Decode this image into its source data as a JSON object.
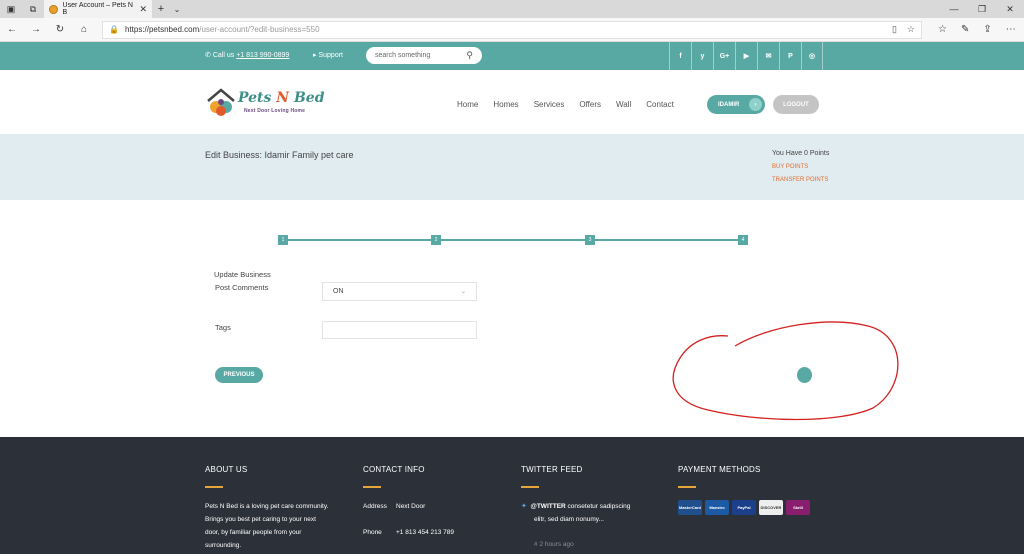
{
  "browser": {
    "tab_title": "User Account – Pets N B",
    "url_host": "https://petsnbed.com",
    "url_path": "/user-account/?edit-business=550"
  },
  "topbar": {
    "call_prefix": "Call us",
    "phone": "+1 813 990-0899",
    "support": "Support",
    "search_placeholder": "search something",
    "social": [
      "f",
      "y",
      "G+",
      "▶",
      "✉",
      "P",
      "◎"
    ]
  },
  "logo": {
    "pets": "Pets",
    "n": "N",
    "bed": "Bed",
    "tagline": "Next Door Loving Home"
  },
  "nav": [
    "Home",
    "Homes",
    "Services",
    "Offers",
    "Wall",
    "Contact"
  ],
  "user_button": "IDAMIR",
  "logout_button": "LOGOUT",
  "band": {
    "title": "Edit Business: Idamir Family pet care",
    "points": "You Have 0 Points",
    "buy": "BUY POINTS",
    "transfer": "TRANSFER POINTS"
  },
  "steps": [
    "1",
    "2",
    "3",
    "4"
  ],
  "form": {
    "section": "Update Business",
    "post_comments_label": "Post Comments",
    "post_comments_value": "ON",
    "tags_label": "Tags",
    "tags_value": "",
    "previous": "PREVIOUS"
  },
  "footer": {
    "about_title": "ABOUT US",
    "about_lines": [
      "Pets N Bed is a loving pet care community.",
      "Brings you best pet caring to your next",
      "door, by familiar people from your",
      "surrounding."
    ],
    "contact_title": "CONTACT INFO",
    "address_label": "Address",
    "address_value": "Next Door",
    "phone_label": "Phone",
    "phone_value": "+1 813 454 213 789",
    "twitter_title": "TWITTER FEED",
    "tweet_handle": "@TWITTER",
    "tweet_text1": "consetetur sadipscing",
    "tweet_text2": "elitr, sed diam nonumy...",
    "tweet_time": "2 hours ago",
    "payment_title": "PAYMENT METHODS",
    "payments": [
      "MasterCard",
      "Maestro",
      "PayPal",
      "DISCOVER",
      "Skrill"
    ]
  },
  "colors": {
    "teal": "#58a9a4",
    "orange": "#e36b2c",
    "footer_bg": "#2c3039",
    "band_bg": "#e1ecf0",
    "annotation": "#d42020"
  }
}
